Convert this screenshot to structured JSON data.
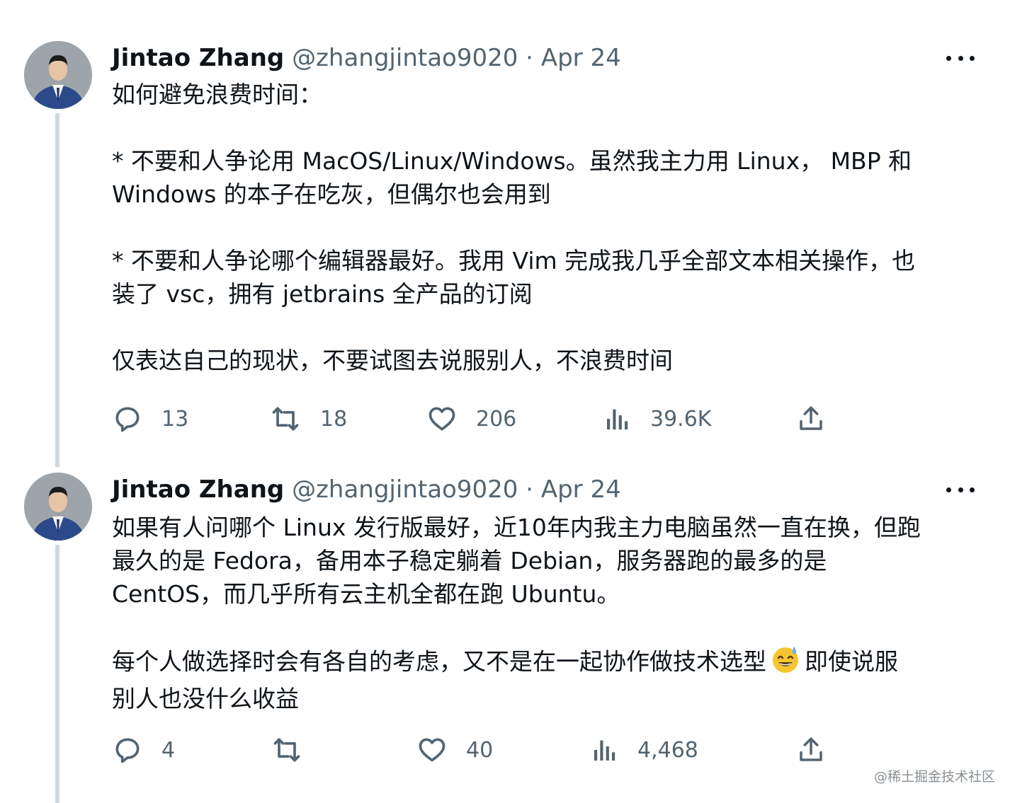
{
  "tweets": [
    {
      "author_name": "Jintao Zhang",
      "handle": "@zhangjintao9020",
      "date": "Apr 24",
      "lines": [
        "如何避免浪费时间：",
        "",
        "* 不要和人争论用 MacOS/Linux/Windows。虽然我主力用 Linux， MBP 和",
        "Windows 的本子在吃灰，但偶尔也会用到",
        "",
        "* 不要和人争论哪个编辑器最好。我用 Vim 完成我几乎全部文本相关操作，也",
        "装了 vsc，拥有 jetbrains 全产品的订阅",
        "",
        "仅表达自己的现状，不要试图去说服别人，不浪费时间"
      ],
      "stats": {
        "replies": "13",
        "retweets": "18",
        "likes": "206",
        "views": "39.6K"
      }
    },
    {
      "author_name": "Jintao Zhang",
      "handle": "@zhangjintao9020",
      "date": "Apr 24",
      "lines": [
        "如果有人问哪个 Linux 发行版最好，近10年内我主力电脑虽然一直在换，但跑",
        "最久的是 Fedora，备用本子稳定躺着 Debian，服务器跑的最多的是",
        "CentOS，而几乎所有云主机全都在跑 Ubuntu。",
        ""
      ],
      "line5_part1": "每个人做选择时会有各自的考虑，又不是在一起协作做技术选型",
      "line5_part2": "即使说服",
      "line6": "别人也没什么收益",
      "stats": {
        "replies": "4",
        "retweets": "",
        "likes": "40",
        "views": "4,468"
      }
    }
  ],
  "separator": " · ",
  "watermark": "@稀土掘金技术社区",
  "icons": [
    "reply-icon",
    "retweet-icon",
    "like-icon",
    "views-icon",
    "share-icon",
    "more-icon",
    "sweat-smile-emoji"
  ],
  "colors": {
    "text": "#0f1419",
    "secondary": "#536471",
    "thread_line": "#cfd9de"
  }
}
